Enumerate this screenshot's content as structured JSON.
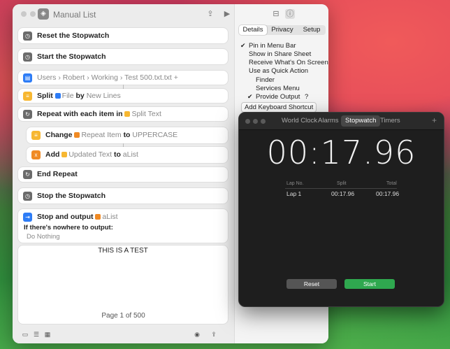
{
  "window": {
    "title": "Manual List"
  },
  "actions": {
    "reset_stopwatch": "Reset the Stopwatch",
    "start_stopwatch": "Start the Stopwatch",
    "path": [
      "Users",
      "Robert",
      "Working",
      "Test 500.txt.txt"
    ],
    "path_add": "+",
    "split": {
      "verb": "Split",
      "token": "File",
      "by": "by",
      "sep": "New Lines"
    },
    "repeat": {
      "label": "Repeat with each item in",
      "token": "Split Text"
    },
    "change": {
      "verb": "Change",
      "token": "Repeat Item",
      "to": "to",
      "value": "UPPERCASE"
    },
    "add": {
      "verb": "Add",
      "token": "Updated Text",
      "to": "to",
      "value": "aList"
    },
    "end_repeat": "End Repeat",
    "stop_stopwatch": "Stop the Stopwatch",
    "stop_output": {
      "verb": "Stop and output",
      "token": "aList",
      "nowhere": "If there's nowhere to output:",
      "value": "Do Nothing"
    }
  },
  "preview": {
    "text": "THIS IS A TEST",
    "page": "Page 1 of 500"
  },
  "inspector": {
    "tabs": [
      "Details",
      "Privacy",
      "Setup"
    ],
    "options": [
      {
        "label": "Pin in Menu Bar",
        "checked": "✔"
      },
      {
        "label": "Show in Share Sheet",
        "checked": ""
      },
      {
        "label": "Receive What's On Screen",
        "checked": ""
      },
      {
        "label": "Use as Quick Action",
        "checked": ""
      },
      {
        "label": "Finder",
        "checked": ""
      },
      {
        "label": "Services Menu",
        "checked": ""
      },
      {
        "label": "Provide Output",
        "checked": "✔"
      }
    ],
    "help": "?",
    "shortcut_button": "Add Keyboard Shortcut"
  },
  "clock": {
    "tabs": [
      "World Clock",
      "Alarms",
      "Stopwatch",
      "Timers"
    ],
    "plus": "+",
    "time": "00:17.96",
    "lap_headers": [
      "Lap No.",
      "Split",
      "Total"
    ],
    "lap": [
      "Lap 1",
      "00:17.96",
      "00:17.96"
    ],
    "reset_label": "Reset",
    "start_label": "Start"
  },
  "colors": {
    "stopwatch_icon": "#6b6b6b",
    "file_icon": "#2d7cf6",
    "split_icon": "#f7b731",
    "variable_icon": "#f08a24",
    "stop_output_icon": "#2d7cf6",
    "start_button": "#2fa84f",
    "reset_button": "#555555"
  }
}
